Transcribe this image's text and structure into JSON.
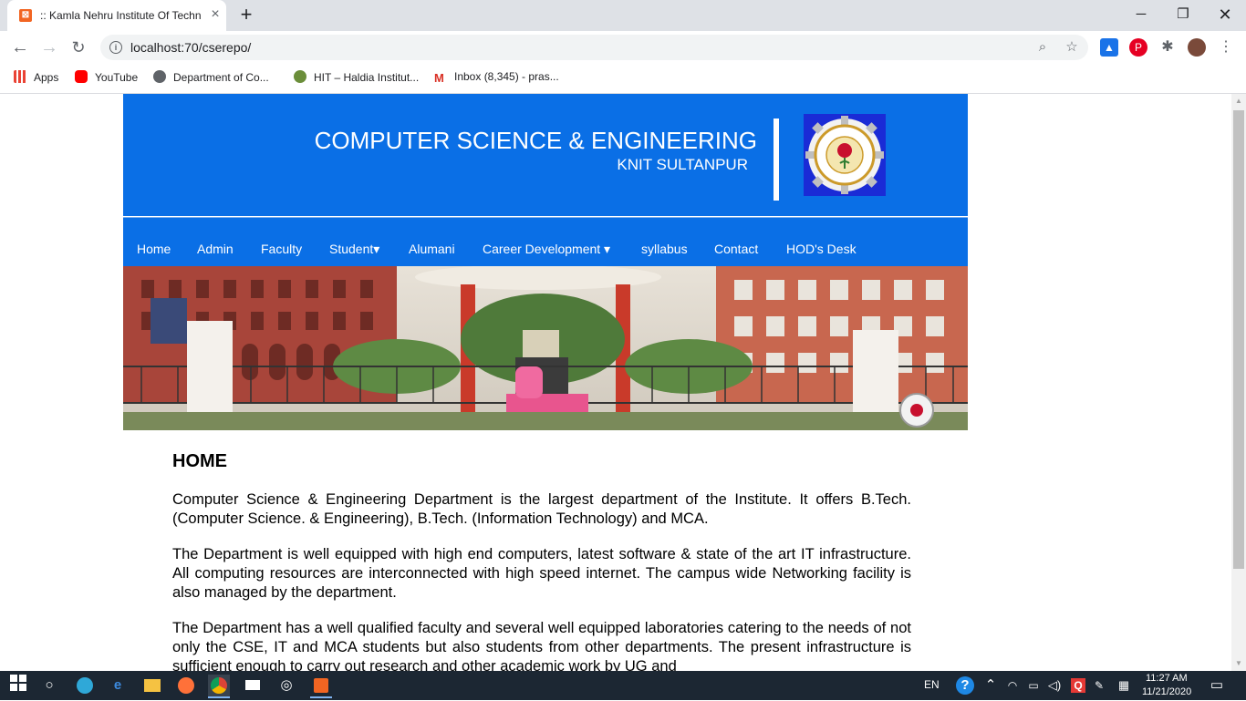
{
  "browser": {
    "tab_title": ":: Kamla Nehru Institute Of Techn",
    "url": "localhost:70/cserepo/",
    "bookmarks": [
      {
        "label": "Apps"
      },
      {
        "label": "YouTube"
      },
      {
        "label": "Department of Co..."
      },
      {
        "label": "HIT – Haldia Institut..."
      },
      {
        "label": "Inbox (8,345) - pras..."
      }
    ]
  },
  "header": {
    "title": "COMPUTER SCIENCE & ENGINEERING",
    "subtitle": "KNIT SULTANPUR"
  },
  "nav": {
    "items": [
      {
        "label": "Home"
      },
      {
        "label": "Admin"
      },
      {
        "label": "Faculty"
      },
      {
        "label": "Student▾"
      },
      {
        "label": "Alumani"
      },
      {
        "label": "Career Development ▾"
      },
      {
        "label": "syllabus"
      },
      {
        "label": "Contact"
      },
      {
        "label": "HOD's Desk"
      }
    ]
  },
  "content": {
    "heading": "HOME",
    "paragraphs": [
      "Computer Science & Engineering Department is the largest department of the Institute. It offers B.Tech. (Computer Science. & Engineering), B.Tech. (Information Technology) and MCA.",
      "The Department is well equipped with high end computers, latest software & state of the art IT infrastructure. All computing resources are interconnected with high speed internet. The campus wide Networking facility is also managed by the department.",
      "The Department has a well qualified faculty and several well equipped laboratories catering to the needs of not only the CSE, IT and MCA students but also students from other departments. The present infrastructure is sufficient enough to carry out research and other academic work by UG and"
    ]
  },
  "taskbar": {
    "language": "EN",
    "time": "11:27 AM",
    "date": "11/21/2020"
  },
  "colors": {
    "brand_blue": "#0a6fe6"
  }
}
